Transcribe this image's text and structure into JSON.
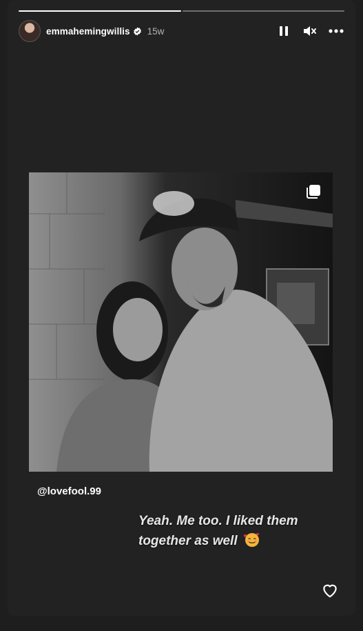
{
  "story": {
    "segments": [
      {
        "progress": 1.0
      },
      {
        "progress": 0.0
      }
    ],
    "username": "emmahemingwillis",
    "verified": true,
    "posted_ago": "15w",
    "icons": {
      "pause": "pause-icon",
      "mute": "muted-speaker-icon",
      "more": "more-options-icon",
      "carousel": "carousel-multiple-icon",
      "like": "heart-outline-icon",
      "emoji": "smiling-face-with-hearts-emoji"
    }
  },
  "reshared_post": {
    "photo": "black-and-white photo of a woman and a man in a baseball cap posing together",
    "mention": "@lovefool.99"
  },
  "caption": {
    "line1": "Yeah. Me too. I liked them",
    "line2": "together as well"
  },
  "colors": {
    "background": "#1e1e1e",
    "frame": "#222222",
    "text": "#ffffff",
    "muted_text": "#b4b4b4",
    "verified_badge": "#ffffff"
  }
}
